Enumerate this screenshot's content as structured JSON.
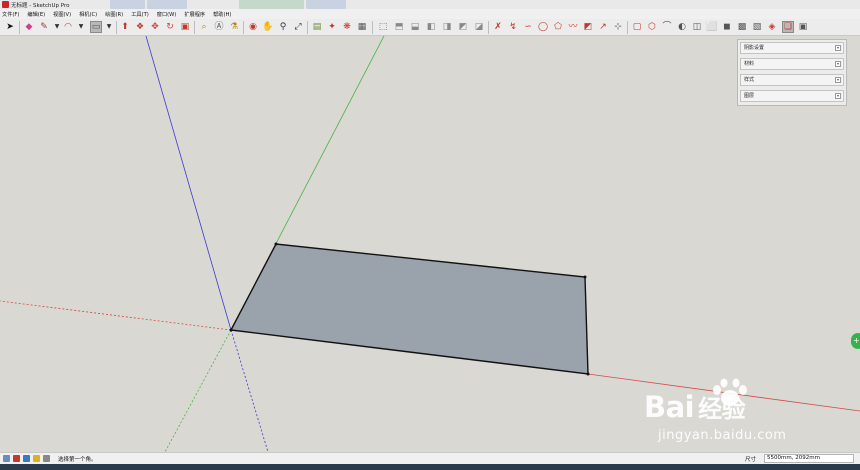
{
  "window": {
    "title": "无标题 - SketchUp Pro"
  },
  "menu": {
    "items": [
      "文件(F)",
      "编辑(E)",
      "视图(V)",
      "相机(C)",
      "绘图(R)",
      "工具(T)",
      "窗口(W)",
      "扩展程序",
      "帮助(H)"
    ]
  },
  "toolbar": {
    "icons": [
      "select-arrow-icon",
      "eraser-icon",
      "pencil-line-icon",
      "arc-icon",
      "rectangle-icon",
      "push-pull-icon",
      "move-icon",
      "rotate-icon",
      "scale-icon",
      "tape-measure-icon",
      "paint-bucket-icon",
      "orbit-icon",
      "pan-icon",
      "zoom-icon",
      "zoom-extents-icon",
      "warehouse-icon",
      "extension-icon",
      "camera-views-icon",
      "style-icon",
      "sandbox-icon",
      "section-plane-icon",
      "solid-tools-icon",
      "component-icon"
    ]
  },
  "tray": {
    "panels": [
      {
        "label": "阴影设置"
      },
      {
        "label": "材料"
      },
      {
        "label": "样式"
      },
      {
        "label": "图层"
      }
    ]
  },
  "model": {
    "face_fill": "#9aa3ab",
    "edge_color": "#111111",
    "axis_red": "#d24a4a",
    "axis_green": "#45b545",
    "axis_blue": "#3b3bd0"
  },
  "watermark": {
    "brand": "Bai",
    "brand_cn": "经验",
    "url": "jingyan.baidu.com"
  },
  "status": {
    "text": "选择第一个角。",
    "measure_label": "尺寸",
    "measure_value": "5500mm, 2092mm"
  }
}
